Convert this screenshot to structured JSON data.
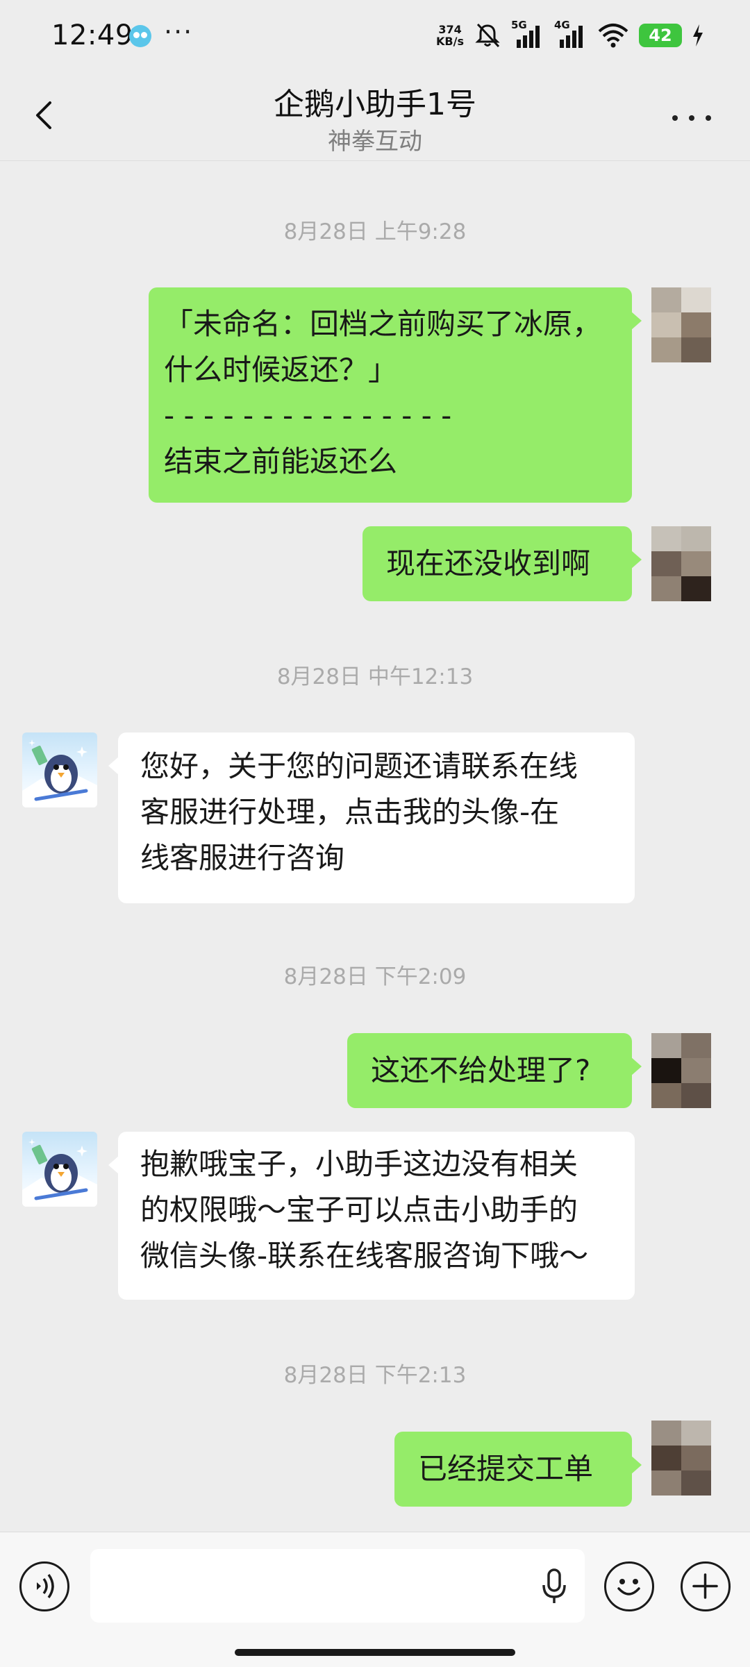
{
  "status_bar": {
    "time": "12:49",
    "more": "···",
    "net_speed_value": "374",
    "net_speed_unit": "KB/s",
    "sig1_label": "5G",
    "sig2_label": "4G",
    "battery": "42"
  },
  "header": {
    "title": "企鹅小助手1号",
    "subtitle": "神拳互动"
  },
  "messages": [
    {
      "type": "time",
      "text": "8月28日 上午9:28"
    },
    {
      "type": "out",
      "lines": [
        "「未命名：回档之前购买了冰原，",
        "什么时候返还？」",
        "- - - - - - - - - - - - - - -",
        "结束之前能返还么"
      ]
    },
    {
      "type": "out",
      "lines": [
        "现在还没收到啊"
      ]
    },
    {
      "type": "time",
      "text": "8月28日 中午12:13"
    },
    {
      "type": "in",
      "lines": [
        "您好，关于您的问题还请联系在线",
        "客服进行处理，点击我的头像-在",
        "线客服进行咨询"
      ]
    },
    {
      "type": "time",
      "text": "8月28日 下午2:09"
    },
    {
      "type": "out",
      "lines": [
        "这还不给处理了?"
      ]
    },
    {
      "type": "in",
      "lines": [
        "抱歉哦宝子，小助手这边没有相关",
        "的权限哦～宝子可以点击小助手的",
        "微信头像-联系在线客服咨询下哦～"
      ]
    },
    {
      "type": "time",
      "text": "8月28日 下午2:13"
    },
    {
      "type": "out",
      "lines": [
        "已经提交工单"
      ]
    }
  ],
  "input_bar": {
    "voice_icon": "voice-mode-icon",
    "mic_icon": "microphone-icon",
    "emoji_icon": "emoji-icon",
    "plus_icon": "plus-icon"
  },
  "colors": {
    "outgoing_bubble": "#95ec69",
    "incoming_bubble": "#ffffff",
    "background": "#ededed",
    "timestamp": "#aaaaaa",
    "battery": "#3ec53e"
  }
}
